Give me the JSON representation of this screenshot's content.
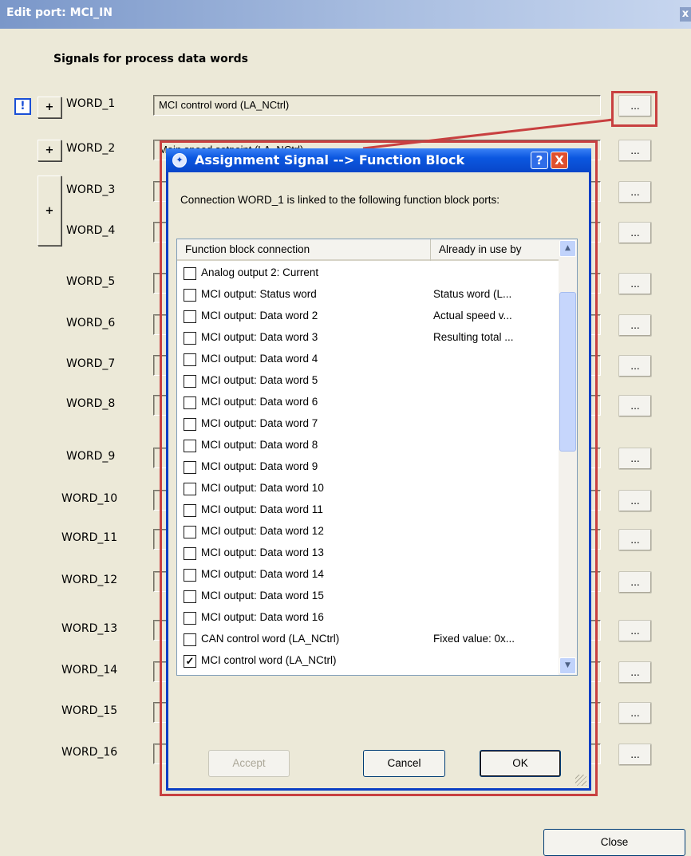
{
  "window": {
    "title": "Edit port: MCI_IN",
    "close_glyph": "x"
  },
  "section_title": "Signals for process data words",
  "warning_icon_glyph": "!",
  "plus_glyph": "+",
  "dots_label": "...",
  "words": [
    {
      "label": "WORD_1",
      "value": "MCI control word (LA_NCtrl)"
    },
    {
      "label": "WORD_2",
      "value": "Main speed setpoint (LA_NCtrl)"
    },
    {
      "label": "WORD_3",
      "value": ""
    },
    {
      "label": "WORD_4",
      "value": ""
    },
    {
      "label": "WORD_5",
      "value": ""
    },
    {
      "label": "WORD_6",
      "value": ""
    },
    {
      "label": "WORD_7",
      "value": ""
    },
    {
      "label": "WORD_8",
      "value": ""
    },
    {
      "label": "WORD_9",
      "value": ""
    },
    {
      "label": "WORD_10",
      "value": ""
    },
    {
      "label": "WORD_11",
      "value": ""
    },
    {
      "label": "WORD_12",
      "value": ""
    },
    {
      "label": "WORD_13",
      "value": ""
    },
    {
      "label": "WORD_14",
      "value": ""
    },
    {
      "label": "WORD_15",
      "value": ""
    },
    {
      "label": "WORD_16",
      "value": ""
    }
  ],
  "dialog": {
    "title": "Assignment Signal --> Function Block",
    "help_glyph": "?",
    "close_glyph": "X",
    "message": "Connection WORD_1 is linked to the following function block ports:",
    "columns": [
      "Function block connection",
      "Already in use by"
    ],
    "rows": [
      {
        "label": "Analog output 2: Current",
        "in_use": "",
        "checked": false
      },
      {
        "label": "MCI output: Status word",
        "in_use": "Status word (L...",
        "checked": false
      },
      {
        "label": "MCI output: Data word 2",
        "in_use": "Actual speed v...",
        "checked": false
      },
      {
        "label": "MCI output: Data word 3",
        "in_use": "Resulting total ...",
        "checked": false
      },
      {
        "label": "MCI output: Data word 4",
        "in_use": "",
        "checked": false
      },
      {
        "label": "MCI output: Data word 5",
        "in_use": "",
        "checked": false
      },
      {
        "label": "MCI output: Data word 6",
        "in_use": "",
        "checked": false
      },
      {
        "label": "MCI output: Data word 7",
        "in_use": "",
        "checked": false
      },
      {
        "label": "MCI output: Data word 8",
        "in_use": "",
        "checked": false
      },
      {
        "label": "MCI output: Data word 9",
        "in_use": "",
        "checked": false
      },
      {
        "label": "MCI output: Data word 10",
        "in_use": "",
        "checked": false
      },
      {
        "label": "MCI output: Data word 11",
        "in_use": "",
        "checked": false
      },
      {
        "label": "MCI output: Data word 12",
        "in_use": "",
        "checked": false
      },
      {
        "label": "MCI output: Data word 13",
        "in_use": "",
        "checked": false
      },
      {
        "label": "MCI output: Data word 14",
        "in_use": "",
        "checked": false
      },
      {
        "label": "MCI output: Data word 15",
        "in_use": "",
        "checked": false
      },
      {
        "label": "MCI output: Data word 16",
        "in_use": "",
        "checked": false
      },
      {
        "label": "CAN control word (LA_NCtrl)",
        "in_use": "Fixed value: 0x...",
        "checked": false
      },
      {
        "label": "MCI control word (LA_NCtrl)",
        "in_use": "",
        "checked": true
      }
    ],
    "check_glyph": "✓",
    "scroll_up_glyph": "▲",
    "scroll_down_glyph": "▼",
    "buttons": {
      "accept": "Accept",
      "cancel": "Cancel",
      "ok": "OK"
    }
  },
  "close_button": "Close",
  "colors": {
    "window_bg": "#ece9d8",
    "highlight": "#c84040",
    "xp_blue": "#0846c9"
  }
}
